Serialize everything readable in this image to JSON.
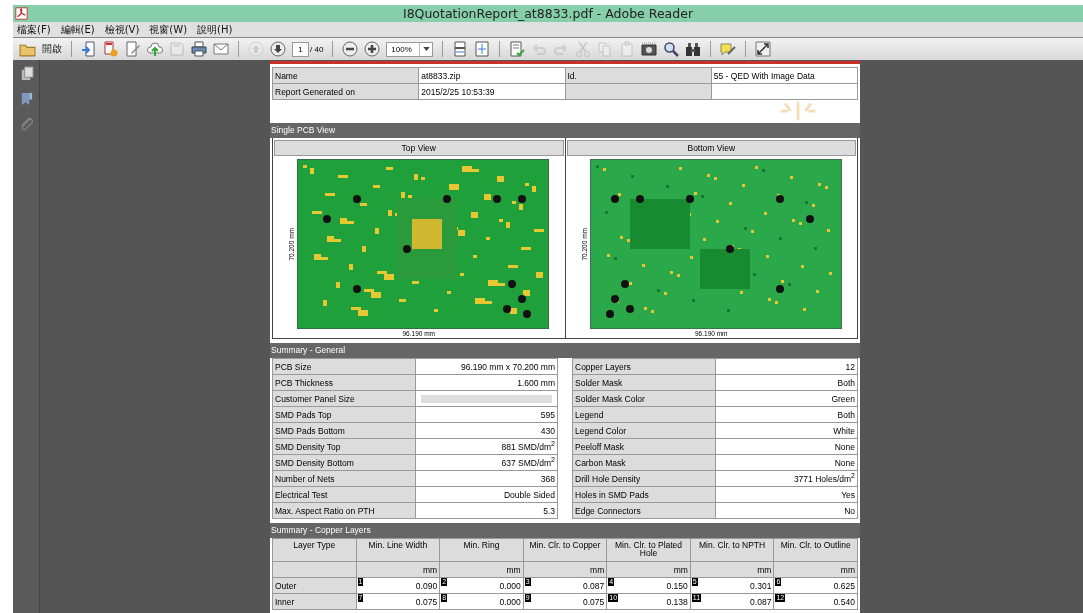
{
  "window": {
    "title": "I8QuotationReport_at8833.pdf - Adobe Reader"
  },
  "menu": [
    {
      "label": "檔案(F)"
    },
    {
      "label": "編輯(E)"
    },
    {
      "label": "檢視(V)"
    },
    {
      "label": "視窗(W)"
    },
    {
      "label": "說明(H)"
    }
  ],
  "toolbar": {
    "groups": [
      [
        {
          "kind": "open",
          "label": "開啟",
          "disabled": false
        }
      ],
      [
        {
          "kind": "import",
          "disabled": false
        },
        {
          "kind": "create",
          "disabled": false
        },
        {
          "kind": "edit",
          "disabled": false
        },
        {
          "kind": "cloud",
          "disabled": false
        },
        {
          "kind": "save",
          "disabled": true
        },
        {
          "kind": "print",
          "disabled": false
        },
        {
          "kind": "email",
          "disabled": false
        }
      ],
      [
        {
          "kind": "prev",
          "disabled": true
        },
        {
          "kind": "next",
          "disabled": false
        },
        {
          "kind": "page",
          "value": "1",
          "total": "/ 40",
          "disabled": false
        }
      ],
      [
        {
          "kind": "zoomout",
          "disabled": false
        },
        {
          "kind": "zoomin",
          "disabled": false
        },
        {
          "kind": "zoom",
          "value": "100%",
          "disabled": false
        }
      ],
      [
        {
          "kind": "fitwidth",
          "disabled": false
        },
        {
          "kind": "fitpage",
          "disabled": false
        }
      ],
      [
        {
          "kind": "sign",
          "disabled": false
        },
        {
          "kind": "undo",
          "disabled": true
        },
        {
          "kind": "redo",
          "disabled": true
        },
        {
          "kind": "cut",
          "disabled": true
        },
        {
          "kind": "copy",
          "disabled": true
        },
        {
          "kind": "paste",
          "disabled": true
        },
        {
          "kind": "snapshot",
          "disabled": false
        },
        {
          "kind": "search",
          "disabled": false
        },
        {
          "kind": "binoculars",
          "disabled": false
        }
      ],
      [
        {
          "kind": "comment",
          "disabled": false
        }
      ],
      [
        {
          "kind": "expand",
          "disabled": false
        }
      ]
    ]
  },
  "sidebar": [
    {
      "kind": "pages"
    },
    {
      "kind": "bookmarks"
    },
    {
      "kind": "attachment"
    }
  ],
  "info_rows": [
    {
      "label": "Name",
      "value": "at8833.zip",
      "label_2": "Id.",
      "value_2": "55 - QED With Image Data"
    },
    {
      "label": "Report Generated on",
      "value": "2015/2/25  10:53:39"
    }
  ],
  "pcb_view": {
    "title": "Single PCB View",
    "views": [
      {
        "heading": "Top View",
        "kind": "top",
        "width_label": "96.190 mm",
        "height_label": "70.200 mm"
      },
      {
        "heading": "Bottom View",
        "kind": "bottom",
        "width_label": "96.190 mm",
        "height_label": "70.200 mm"
      }
    ]
  },
  "general": {
    "title": "Summary - General",
    "rows": [
      {
        "label": "PCB Size",
        "value": "96.190 mm x 70.200 mm",
        "label_2": "Copper Layers",
        "value_2": "12"
      },
      {
        "label": "PCB Thickness",
        "value": "1.600 mm",
        "label_2": "Solder Mask",
        "value_2": "Both"
      },
      {
        "label": "Customer Panel Size",
        "label_2": "Solder Mask Color",
        "value_2": "Green"
      },
      {
        "label": "SMD Pads Top",
        "value": "595",
        "label_2": "Legend",
        "value_2": "Both"
      },
      {
        "label": "SMD Pads Bottom",
        "value": "430",
        "label_2": "Legend Color",
        "value_2": "White"
      },
      {
        "label": "SMD Density Top",
        "value": "881 SMD/dm$^{2}$",
        "label_2": "Peeloff Mask",
        "value_2": "None"
      },
      {
        "label": "SMD Density Bottom",
        "value": "637 SMD/dm$^{2}$",
        "label_2": "Carbon Mask",
        "value_2": "None"
      },
      {
        "label": "Number of Nets",
        "value": "368",
        "label_2": "Drill Hole Density",
        "value_2": "3771 Holes/dm$^{2}$"
      },
      {
        "label": "Electrical Test",
        "value": "Double Sided",
        "label_2": "Holes in SMD Pads",
        "value_2": "Yes"
      },
      {
        "label": "Max. Aspect Ratio on PTH",
        "value": "5.3",
        "label_2": "Edge Connectors",
        "value_2": "No"
      }
    ]
  },
  "copper": {
    "title": "Summary - Copper Layers",
    "columns": [
      "Layer Type",
      "Min. Line Width",
      "Min. Ring",
      "Min. Clr. to Copper",
      "Min. Clr. to Plated Hole",
      "Min. Clr. to NPTH",
      "Min. Clr. to Outline"
    ],
    "units": [
      "mm",
      "mm",
      "mm",
      "mm",
      "mm",
      "mm"
    ],
    "rows": [
      {
        "cells": [
          {
            "value": "Outer"
          },
          {
            "index": "1",
            "value": "0.090"
          },
          {
            "index": "2",
            "value": "0.000"
          },
          {
            "index": "3",
            "value": "0.087"
          },
          {
            "index": "4",
            "value": "0.150"
          },
          {
            "index": "5",
            "value": "0.301"
          },
          {
            "index": "6",
            "value": "0.625"
          }
        ]
      },
      {
        "cells": [
          {
            "value": "Inner"
          },
          {
            "index": "7",
            "value": "0.075"
          },
          {
            "index": "8",
            "value": "0.000"
          },
          {
            "index": "9",
            "value": "0.075"
          },
          {
            "index": "10",
            "value": "0.138"
          },
          {
            "index": "11",
            "value": "0.087"
          },
          {
            "index": "12",
            "value": "0.540"
          }
        ]
      }
    ]
  }
}
